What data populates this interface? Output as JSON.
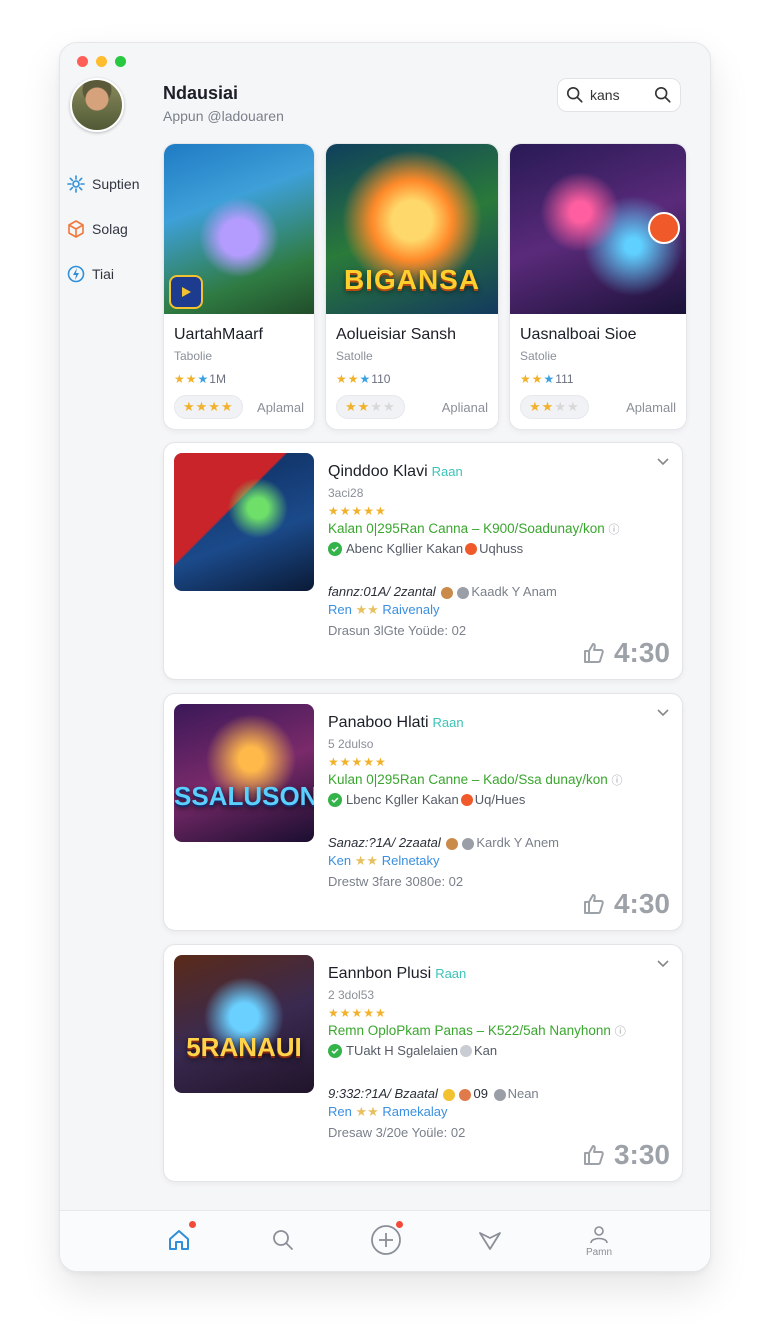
{
  "header": {
    "app_name": "Ndausiai",
    "handle": "Appun @ladouaren",
    "search_label": "kans"
  },
  "sidebar": {
    "items": [
      {
        "label": "Suptien",
        "icon": "gear-icon"
      },
      {
        "label": "Solag",
        "icon": "cube-icon"
      },
      {
        "label": "Tiai",
        "icon": "bolt-icon"
      }
    ]
  },
  "featured": [
    {
      "title": "UartahMaarf",
      "sub": "Tabolie",
      "rating": "1M",
      "action": "Aplamal",
      "pill_on": 4,
      "pill_total": 4
    },
    {
      "title": "Aolueisiar Sansh",
      "sub": "Satolle",
      "rating": "110",
      "action": "Aplianal",
      "art_title": "BIGANSA",
      "pill_on": 2,
      "pill_total": 4
    },
    {
      "title": "Uasnalboai Sioe",
      "sub": "Satolie",
      "rating": "111",
      "action": "Aplamall",
      "pill_on": 2,
      "pill_total": 4
    }
  ],
  "list": [
    {
      "name": "Qinddoo Klavi",
      "tag": "Raan",
      "sub": "3aci28",
      "green": "Kalan 0|295Ran Canna – K900/Soadunay/kon",
      "meta": "Abenc Kgllier Kakan",
      "meta_tail": "Uqhuss",
      "line2": "fannz:01A/ 2zantal",
      "line2_tail": "Kaadk Y Anam",
      "line3_a": "Ren",
      "line3_b": "Raivenaly",
      "line4": "Drasun 3lGte Yoüde: 02",
      "time": "4:30"
    },
    {
      "name": "Panaboo Hlati",
      "tag": "Raan",
      "sub": "5 2dulso",
      "art_title": "SSALUSON",
      "green": "Kulan 0|295Ran Canne – Kado/Ssa dunay/kon",
      "meta": "Lbenc Kgller Kakan",
      "meta_tail": "Uq/Hues",
      "line2": "Sanaz:?1A/ 2zaatal",
      "line2_tail": "Kardk Y Anem",
      "line3_a": "Ken",
      "line3_b": "Relnetaky",
      "line4": "Drestw 3fare 3080e: 02",
      "time": "4:30"
    },
    {
      "name": "Eannbon Plusi",
      "tag": "Raan",
      "sub": "2 3dol53",
      "art_title": "5RANAUI",
      "green": "Remn OploPkam Panas – K522/5ah Nanyhonn",
      "meta": "TUakt H Sgalelaien",
      "meta_tail": "Kan",
      "line2": "9:332:?1A/ Bzaatal",
      "line2_tail": "09",
      "line2_tail2": "Nean",
      "line3_a": "Ren",
      "line3_b": "Ramekalay",
      "line4": "Dresaw 3/20e Yoüle: 02",
      "time": "3:30"
    }
  ],
  "tabbar": {
    "items": [
      {
        "icon": "home-icon",
        "badge": true
      },
      {
        "icon": "search-icon",
        "badge": false
      },
      {
        "icon": "plus-icon",
        "badge": true
      },
      {
        "icon": "heart-icon",
        "badge": false
      },
      {
        "icon": "profile-icon",
        "label": "Pamn",
        "badge": false
      }
    ]
  },
  "colors": {
    "accent": "#3aa0e0",
    "green": "#3aa62e",
    "star": "#f1b12a",
    "tag": "#3cc3b8"
  }
}
